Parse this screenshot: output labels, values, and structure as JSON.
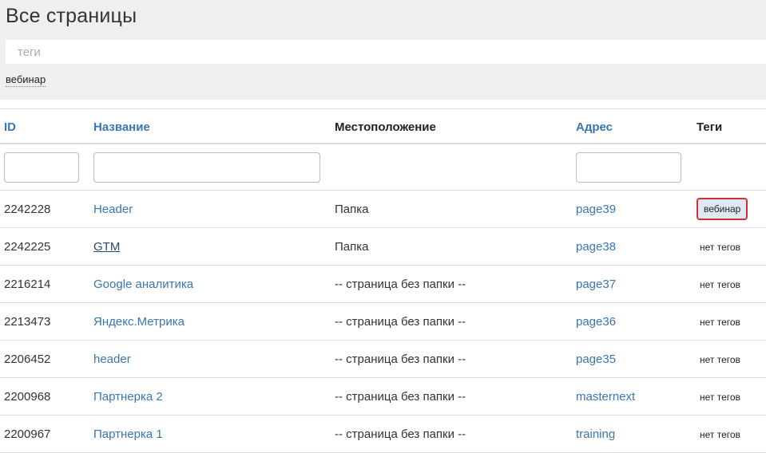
{
  "header": {
    "title": "Все страницы",
    "tags_placeholder": "теги",
    "active_tag": "вебинар"
  },
  "table": {
    "columns": {
      "id": "ID",
      "title": "Название",
      "location": "Местоположение",
      "address": "Адрес",
      "tags": "Теги"
    },
    "rows": [
      {
        "id": "2242228",
        "title": "Header",
        "location": "Папка",
        "address": "page39",
        "tags": "вебинар"
      },
      {
        "id": "2242225",
        "title": "GTM",
        "location": "Папка",
        "address": "page38",
        "tags": "нет тегов"
      },
      {
        "id": "2216214",
        "title": "Google аналитика",
        "location": "-- страница без папки --",
        "address": "page37",
        "tags": "нет тегов"
      },
      {
        "id": "2213473",
        "title": "Яндекс.Метрика",
        "location": "-- страница без папки --",
        "address": "page36",
        "tags": "нет тегов"
      },
      {
        "id": "2206452",
        "title": "header",
        "location": "-- страница без папки --",
        "address": "page35",
        "tags": "нет тегов"
      },
      {
        "id": "2200968",
        "title": "Партнерка 2",
        "location": "-- страница без папки --",
        "address": "masternext",
        "tags": "нет тегов"
      },
      {
        "id": "2200967",
        "title": "Партнерка 1",
        "location": "-- страница без папки --",
        "address": "training",
        "tags": "нет тегов"
      }
    ]
  },
  "colors": {
    "link": "#3a76b0",
    "highlight_border": "#d03030",
    "tag_chip_bg": "#dfe9f3",
    "panel_bg": "#efefef"
  }
}
